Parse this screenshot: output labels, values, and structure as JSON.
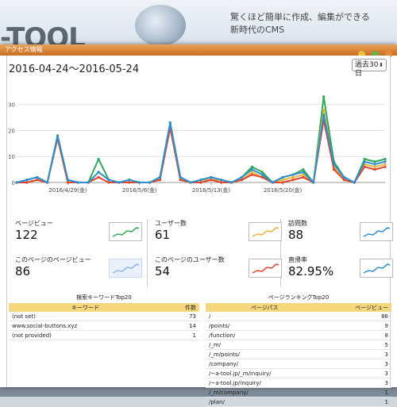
{
  "background": {
    "logo_text": "-TOOL",
    "tagline": [
      "驚くほど簡単に作成、編集ができる",
      "新時代のCMS"
    ]
  },
  "window": {
    "title": "アクセス情報"
  },
  "date_range": "2016-04-24〜2016-05-24",
  "period_select": {
    "value": "過去30日"
  },
  "chart_data": {
    "type": "line",
    "x_tick_labels": [
      "2016/4/29(金)",
      "2016/5/6(金)",
      "2016/5/13(金)",
      "2016/5/20(金)"
    ],
    "x_tick_index": [
      5,
      12,
      19,
      26
    ],
    "yticks": [
      0,
      10,
      20,
      30
    ],
    "ylim": [
      0,
      36
    ],
    "grid": true,
    "n_points": 31,
    "series": [
      {
        "color": "#2eaa57",
        "values": [
          0,
          1,
          2,
          0,
          18,
          1,
          0,
          0,
          9,
          1,
          0,
          1,
          0,
          0,
          2,
          23,
          2,
          0,
          1,
          2,
          1,
          0,
          2,
          6,
          4,
          0,
          2,
          3,
          5,
          0,
          33,
          8,
          2,
          0,
          9,
          8,
          9
        ]
      },
      {
        "color": "#e8b23b",
        "values": [
          0,
          0,
          1,
          0,
          17,
          0,
          0,
          0,
          4,
          1,
          0,
          1,
          0,
          0,
          1,
          22,
          1,
          0,
          1,
          1,
          1,
          0,
          1,
          4,
          2,
          0,
          1,
          2,
          3,
          0,
          28,
          6,
          1,
          0,
          7,
          6,
          7
        ]
      },
      {
        "color": "#e0462f",
        "values": [
          0,
          0,
          1,
          0,
          17,
          0,
          0,
          0,
          2,
          0,
          0,
          0,
          0,
          0,
          1,
          21,
          1,
          0,
          0,
          1,
          0,
          0,
          1,
          3,
          2,
          0,
          0,
          1,
          2,
          0,
          24,
          5,
          1,
          0,
          6,
          5,
          6
        ]
      },
      {
        "color": "#2f8fce",
        "values": [
          0,
          1,
          2,
          0,
          18,
          1,
          0,
          0,
          4,
          1,
          0,
          1,
          0,
          0,
          2,
          23,
          2,
          0,
          1,
          2,
          1,
          0,
          2,
          5,
          3,
          0,
          2,
          3,
          4,
          0,
          26,
          7,
          2,
          0,
          8,
          7,
          8
        ]
      }
    ]
  },
  "metrics": [
    {
      "label": "ページビュー",
      "value": "122",
      "spark_color": "#2eaa57"
    },
    {
      "label": "ユーザー数",
      "value": "61",
      "spark_color": "#e8b23b"
    },
    {
      "label": "訪問数",
      "value": "88",
      "spark_color": "#2f8fce"
    },
    {
      "label": "このページのページビュー",
      "value": "86",
      "spark_color": "#8fb3e3"
    },
    {
      "label": "このページのユーザー数",
      "value": "54",
      "spark_color": "#e0462f"
    },
    {
      "label": "直帰率",
      "value": "82.95%",
      "spark_color": "#2f8fce"
    }
  ],
  "keywords": {
    "caption": "検索キーワードTop20",
    "headers": [
      "キーワード",
      "件数"
    ],
    "rows": [
      [
        "(not set)",
        "73"
      ],
      [
        "www.social-buttons.xyz",
        "14"
      ],
      [
        "(not provided)",
        "1"
      ]
    ]
  },
  "pages": {
    "caption": "ページランキングTop20",
    "headers": [
      "ページパス",
      "ページビュー"
    ],
    "rows": [
      [
        "/",
        "86"
      ],
      [
        "/points/",
        "9"
      ],
      [
        "/function/",
        "8"
      ],
      [
        "/_m/",
        "5"
      ],
      [
        "/_m/points/",
        "3"
      ],
      [
        "/company/",
        "3"
      ],
      [
        "/~a-tool.jp/_m/inquiry/",
        "3"
      ],
      [
        "/~a-tool.jp/inquiry/",
        "3"
      ],
      [
        "/_m/company/",
        "1"
      ],
      [
        "/plan/",
        "1"
      ]
    ]
  }
}
